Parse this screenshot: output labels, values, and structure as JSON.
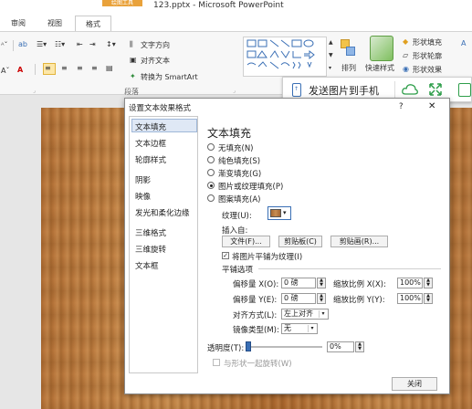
{
  "window": {
    "context_tab": "绘图工具",
    "title": "123.pptx - Microsoft PowerPoint"
  },
  "ribbon_tabs": [
    {
      "label": "审阅"
    },
    {
      "label": "视图"
    },
    {
      "label": "格式"
    }
  ],
  "ribbon": {
    "text_direction": "文字方向",
    "align_text": "对齐文本",
    "convert_smartart": "转换为 SmartArt",
    "arrange": "排列",
    "quick_styles": "快速样式",
    "shape_fill": "形状填充",
    "shape_outline": "形状轮廓",
    "shape_effects": "形状效果",
    "group_paragraph": "段落",
    "font_a": "A"
  },
  "sendbar": {
    "label": "发送图片到手机"
  },
  "dialog": {
    "title": "设置文本效果格式",
    "help": "?",
    "close_glyph": "✕",
    "nav": [
      {
        "label": "文本填充"
      },
      {
        "label": "文本边框"
      },
      {
        "label": "轮廓样式"
      },
      {
        "label": "阴影"
      },
      {
        "label": "映像"
      },
      {
        "label": "发光和柔化边缘"
      },
      {
        "label": "三维格式"
      },
      {
        "label": "三维旋转"
      },
      {
        "label": "文本框"
      }
    ],
    "section_title": "文本填充",
    "fill_options": [
      {
        "label": "无填充(N)",
        "checked": false
      },
      {
        "label": "纯色填充(S)",
        "checked": false
      },
      {
        "label": "渐变填充(G)",
        "checked": false
      },
      {
        "label": "图片或纹理填充(P)",
        "checked": true
      },
      {
        "label": "图案填充(A)",
        "checked": false
      }
    ],
    "texture_label": "纹理(U):",
    "insert_from": "插入自:",
    "file_button": "文件(F)...",
    "clipboard_button": "剪贴板(C)",
    "clipart_button": "剪贴画(R)...",
    "tile_checkbox": "将图片平铺为纹理(I)",
    "tile_checked": true,
    "tiling_options": "平铺选项",
    "offset_x_label": "偏移量 X(O):",
    "offset_x_value": "0 磅",
    "scale_x_label": "缩放比例 X(X):",
    "scale_x_value": "100%",
    "offset_y_label": "偏移量 Y(E):",
    "offset_y_value": "0 磅",
    "scale_y_label": "缩放比例 Y(Y):",
    "scale_y_value": "100%",
    "alignment_label": "对齐方式(L):",
    "alignment_value": "左上对齐",
    "mirror_label": "镜像类型(M):",
    "mirror_value": "无",
    "transparency_label": "透明度(T):",
    "transparency_value": "0%",
    "transparency_level": 0.0,
    "rotate_with_shape": "与形状一起旋转(W)",
    "rotate_checked": false,
    "close_button": "关闭"
  }
}
